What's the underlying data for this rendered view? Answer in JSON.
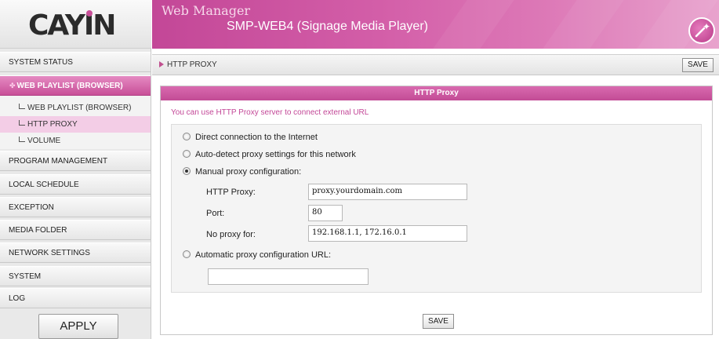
{
  "brand": {
    "logo_text": "CAYIN",
    "accent": "#c84f98"
  },
  "header": {
    "title": "Web Manager",
    "subtitle": "SMP-WEB4 (Signage Media Player)",
    "icon": "magic-wand-icon"
  },
  "sidebar": {
    "items": [
      {
        "label": "SYSTEM STATUS"
      },
      {
        "label": "WEB PLAYLIST (BROWSER)"
      },
      {
        "label": "PROGRAM MANAGEMENT"
      },
      {
        "label": "LOCAL SCHEDULE"
      },
      {
        "label": "EXCEPTION"
      },
      {
        "label": "MEDIA FOLDER"
      },
      {
        "label": "NETWORK SETTINGS"
      },
      {
        "label": "SYSTEM"
      },
      {
        "label": "LOG"
      }
    ],
    "sub_items": [
      {
        "label": "WEB PLAYLIST (BROWSER)"
      },
      {
        "label": "HTTP PROXY"
      },
      {
        "label": "VOLUME"
      }
    ],
    "apply_label": "APPLY"
  },
  "breadcrumb": {
    "text": "HTTP PROXY",
    "save_label": "SAVE"
  },
  "panel": {
    "header": "HTTP Proxy",
    "description": "You can use HTTP Proxy server to connect external URL",
    "options": [
      {
        "label": "Direct connection to the Internet",
        "checked": false
      },
      {
        "label": "Auto-detect proxy settings for this network",
        "checked": false
      },
      {
        "label": "Manual proxy configuration:",
        "checked": true
      },
      {
        "label": "Automatic proxy configuration URL:",
        "checked": false
      }
    ],
    "fields": {
      "http_proxy_label": "HTTP Proxy:",
      "http_proxy_value": "proxy.yourdomain.com",
      "port_label": "Port:",
      "port_value": "80",
      "no_proxy_label": "No proxy for:",
      "no_proxy_value": "192.168.1.1, 172.16.0.1",
      "auto_url_value": ""
    },
    "save_label": "SAVE"
  }
}
